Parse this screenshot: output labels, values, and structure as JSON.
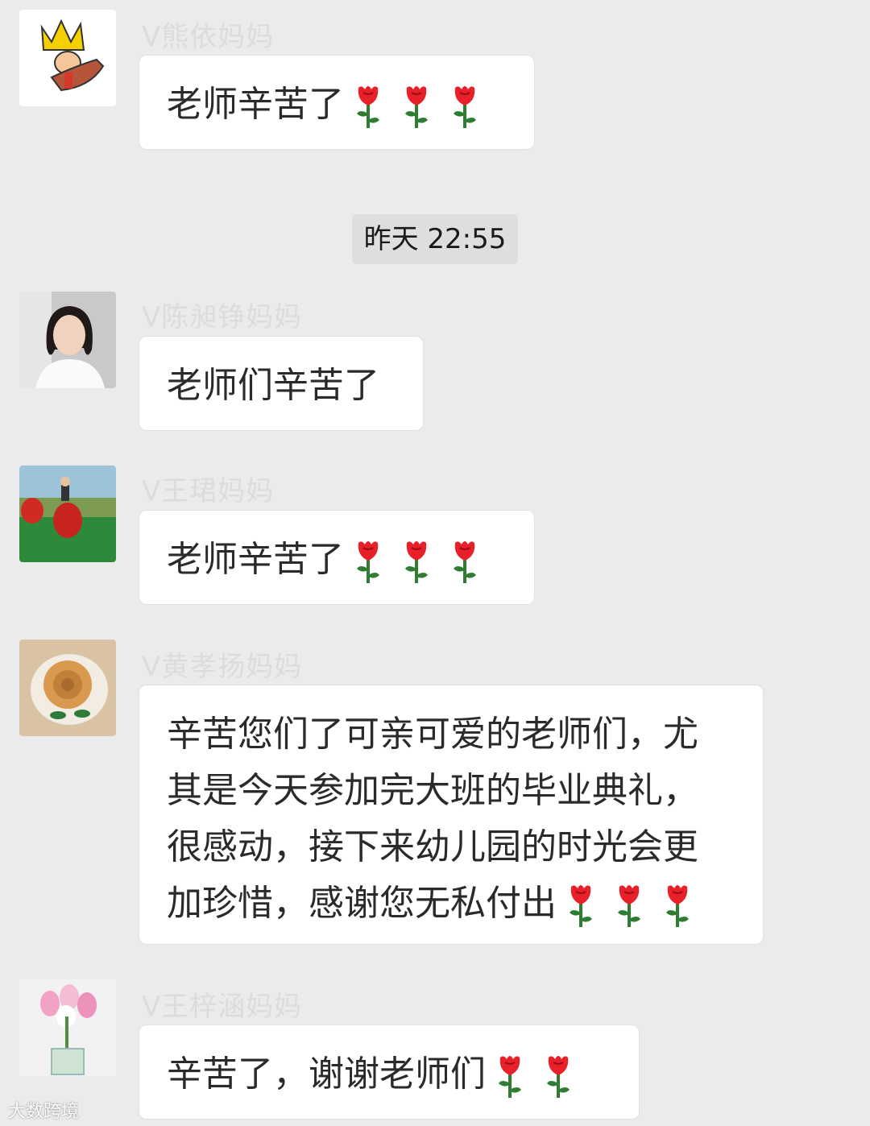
{
  "timestamp": "昨天 22:55",
  "watermark": "大数跨境",
  "messages": [
    {
      "sender": "V熊依妈妈",
      "text": "老师辛苦了",
      "roses": 3,
      "avatar_icon": "crown-horse-cartoon-avatar"
    },
    {
      "sender": "V陈昶铮妈妈",
      "text": "老师们辛苦了",
      "roses": 0,
      "avatar_icon": "woman-portrait-avatar"
    },
    {
      "sender": "V王珺妈妈",
      "text": "老师辛苦了",
      "roses": 3,
      "avatar_icon": "strawberry-lawn-avatar"
    },
    {
      "sender": "V黄孝扬妈妈",
      "text": "辛苦您们了可亲可爱的老师们，尤\n其是今天参加完大班的毕业典礼，\n很感动，接下来幼儿园的时光会更\n加珍惜，感谢您无私付出",
      "roses": 3,
      "avatar_icon": "flower-plate-avatar"
    },
    {
      "sender": "V王梓涵妈妈",
      "text": "辛苦了，谢谢老师们",
      "roses": 2,
      "avatar_icon": "tulip-vase-avatar"
    }
  ],
  "colors": {
    "background": "#ebebeb",
    "bubble": "#ffffff",
    "rose_red": "#e8202a",
    "stem_green": "#2e7d32"
  }
}
